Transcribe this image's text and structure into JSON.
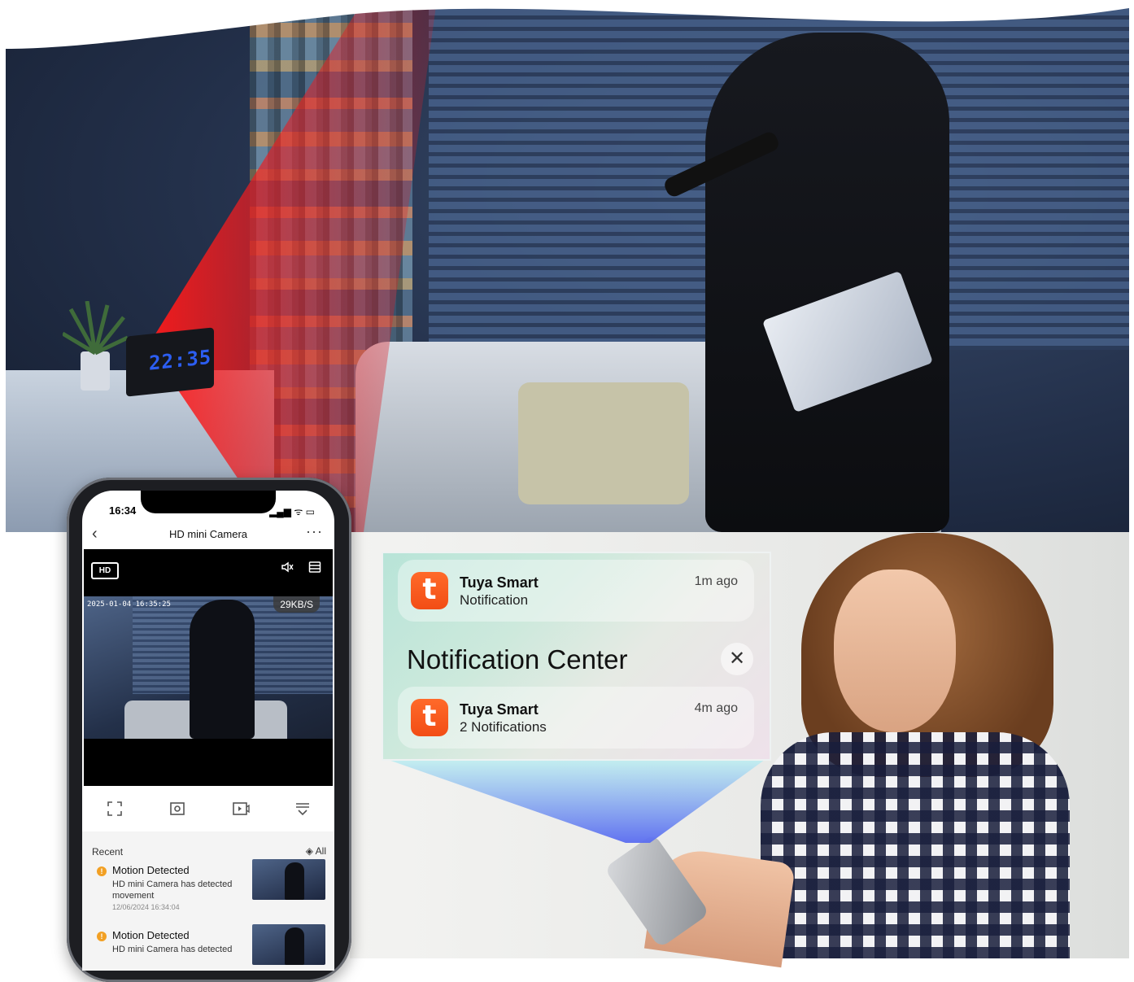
{
  "scene": {
    "clock_display": "22:35"
  },
  "phone": {
    "status_time": "16:34",
    "status_icons": "▂▄▆ ᯤ ▭",
    "app_title": "HD mini Camera",
    "back_icon": "‹",
    "more_icon": "···",
    "hd_label": "HD",
    "mute_icon": "🔇",
    "menu_icon": "☰",
    "timestamp": "2025-01-04  16:35:25",
    "bitrate": "29KB/S",
    "controls": [
      "fullscreen-icon",
      "screenshot-icon",
      "record-icon",
      "more-controls-icon"
    ],
    "recent_label": "Recent",
    "all_label": "All",
    "events": [
      {
        "title": "Motion Detected",
        "description": "HD mini Camera has detected movement",
        "date": "12/06/2024 16:34:04"
      },
      {
        "title": "Motion Detected",
        "description": "HD mini Camera has detected",
        "date": ""
      }
    ]
  },
  "notifications": {
    "center_title": "Notification Center",
    "close_icon": "✕",
    "items": [
      {
        "app": "Tuya Smart",
        "text": "Notification",
        "time": "1m ago",
        "icon_letter": "t"
      },
      {
        "app": "Tuya Smart",
        "text": "2 Notifications",
        "time": "4m ago",
        "icon_letter": "t"
      }
    ]
  },
  "colors": {
    "beam": "#e8121c",
    "tuya_orange": "#f24d15",
    "alert_orange": "#f2a024",
    "light_beam": "#5a6cf0"
  }
}
